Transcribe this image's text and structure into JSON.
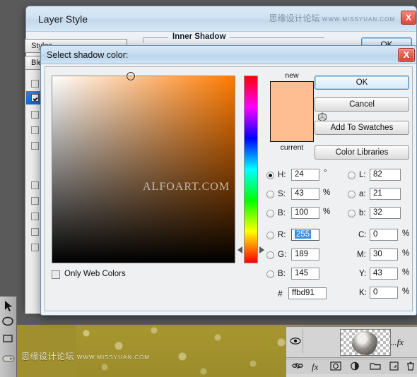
{
  "photoshop": {
    "watermark": "思缘设计论坛",
    "watermark_url": "WWW.MISSYUAN.COM",
    "layers_panel": {
      "fx_label": "...fx",
      "tools": [
        "link-icon",
        "fx-icon",
        "mask-icon",
        "adjustment-icon",
        "group-icon",
        "new-layer-icon",
        "trash-icon"
      ]
    }
  },
  "layer_style": {
    "title": "Layer Style",
    "watermark": "思缘设计论坛",
    "watermark_url": "WWW.MISSYUAN.COM",
    "close_label": "X",
    "styles_label": "Styles",
    "blending_label": "Blending Options",
    "blending_label_short": "Ble",
    "group_title": "Inner Shadow",
    "ok_label": "OK",
    "effects": [
      {
        "label": "",
        "checked": false
      },
      {
        "label": "",
        "checked": true
      },
      {
        "label": "",
        "checked": false
      },
      {
        "label": "",
        "checked": false
      },
      {
        "label": "",
        "checked": false
      },
      {
        "label": "",
        "checked": false
      },
      {
        "label": "",
        "checked": false
      },
      {
        "label": "",
        "checked": false
      },
      {
        "label": "",
        "checked": false
      },
      {
        "label": "",
        "checked": false
      }
    ]
  },
  "picker": {
    "title": "Select shadow color:",
    "close_label": "X",
    "preview": {
      "new_label": "new",
      "current_label": "current",
      "new_color": "#ffbd91",
      "current_color": "#ffbd91"
    },
    "buttons": {
      "ok": "OK",
      "cancel": "Cancel",
      "add_to_swatches": "Add To Swatches",
      "color_libraries": "Color Libraries"
    },
    "only_web_colors": {
      "label": "Only Web Colors",
      "checked": false
    },
    "hsb": {
      "h": {
        "label": "H:",
        "value": "24",
        "unit": "°",
        "selected": true
      },
      "s": {
        "label": "S:",
        "value": "43",
        "unit": "%",
        "selected": false
      },
      "b": {
        "label": "B:",
        "value": "100",
        "unit": "%",
        "selected": false
      }
    },
    "rgb": {
      "r": {
        "label": "R:",
        "value": "255",
        "unit": "",
        "selected": false,
        "highlighted": true
      },
      "g": {
        "label": "G:",
        "value": "189",
        "unit": "",
        "selected": false
      },
      "b": {
        "label": "B:",
        "value": "145",
        "unit": "",
        "selected": false
      }
    },
    "lab": {
      "l": {
        "label": "L:",
        "value": "82",
        "selected": false
      },
      "a": {
        "label": "a:",
        "value": "21",
        "selected": false
      },
      "b": {
        "label": "b:",
        "value": "32",
        "selected": false
      }
    },
    "cmyk": {
      "c": {
        "label": "C:",
        "value": "0",
        "unit": "%"
      },
      "m": {
        "label": "M:",
        "value": "30",
        "unit": "%"
      },
      "y": {
        "label": "Y:",
        "value": "43",
        "unit": "%"
      },
      "k": {
        "label": "K:",
        "value": "0",
        "unit": "%"
      }
    },
    "hex": {
      "symbol": "#",
      "value": "ffbd91"
    },
    "field": {
      "watermark": "ALFOART.COM",
      "hue_color": "#ff7a00",
      "marker_x_pct": 43,
      "marker_y_pct": 0,
      "hue_pos_pct": 93
    }
  }
}
